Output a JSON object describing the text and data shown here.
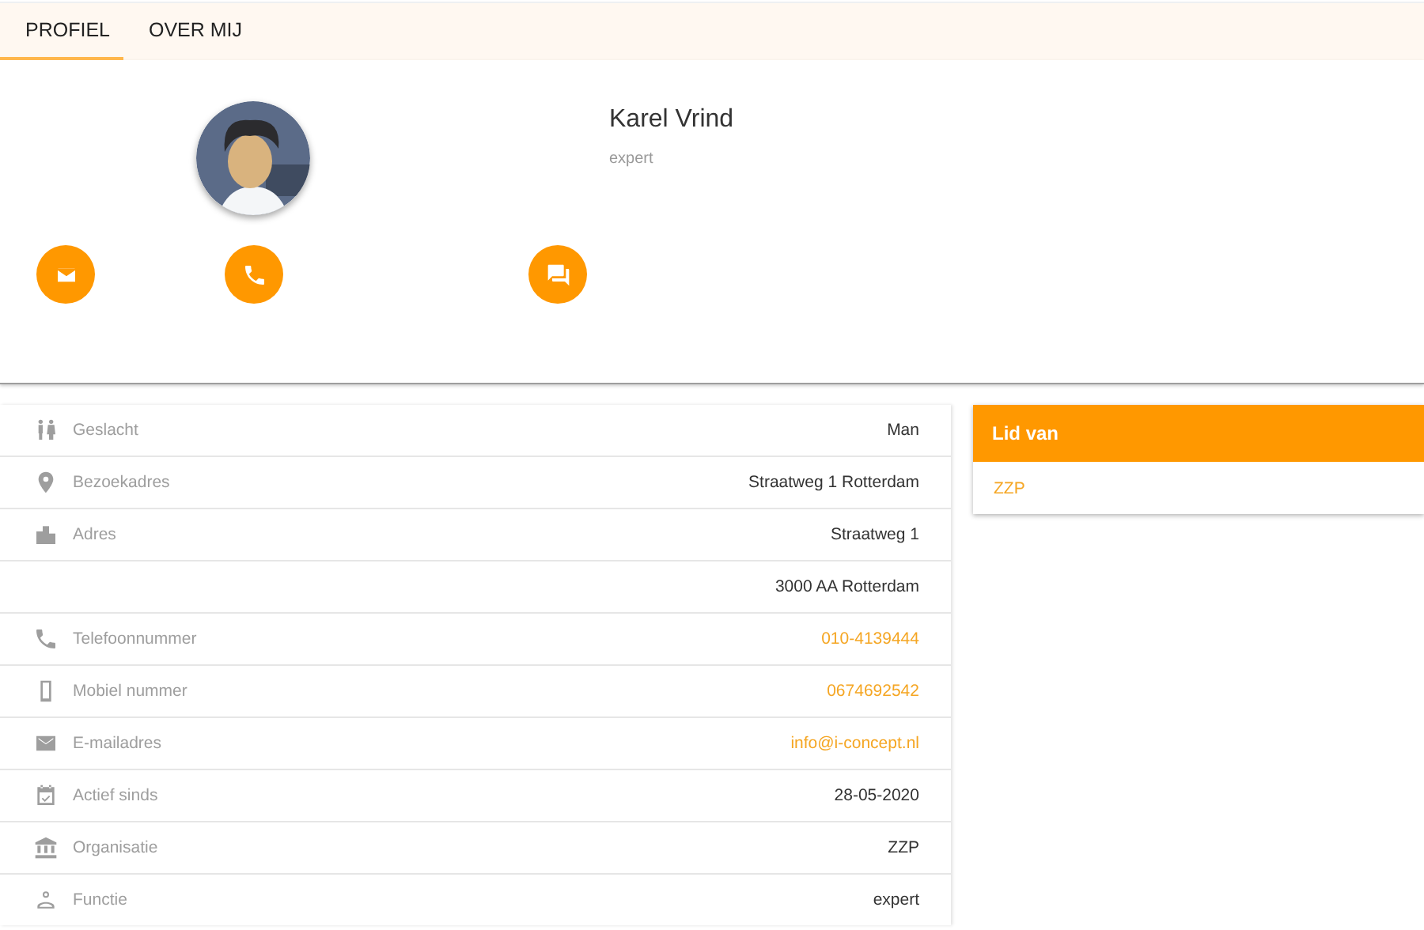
{
  "tabs": [
    {
      "label": "PROFIEL",
      "selected": true
    },
    {
      "label": "OVER MIJ",
      "selected": false
    }
  ],
  "profile": {
    "name": "Karel Vrind",
    "role": "expert",
    "actions": [
      {
        "kind": "mail"
      },
      {
        "kind": "phone"
      },
      {
        "kind": "chat"
      }
    ]
  },
  "details": [
    {
      "kind": "gender",
      "label": "Geslacht",
      "value": "Man",
      "link": false
    },
    {
      "kind": "pin",
      "label": "Bezoekadres",
      "value": "Straatweg 1 Rotterdam",
      "link": false
    },
    {
      "kind": "city",
      "label": "Adres",
      "value": "Straatweg 1",
      "link": false
    },
    {
      "kind": "blank",
      "value": "3000 AA Rotterdam",
      "link": false
    },
    {
      "kind": "phone",
      "label": "Telefoonnummer",
      "value": "010-4139444",
      "link": true
    },
    {
      "kind": "mobile",
      "label": "Mobiel nummer",
      "value": "0674692542",
      "link": true
    },
    {
      "kind": "mail",
      "label": "E-mailadres",
      "value": "info@i-concept.nl",
      "link": true
    },
    {
      "kind": "calendar",
      "label": "Actief sinds",
      "value": "28-05-2020",
      "link": false
    },
    {
      "kind": "bank",
      "label": "Organisatie",
      "value": "ZZP",
      "link": false
    },
    {
      "kind": "person",
      "label": "Functie",
      "value": "expert",
      "link": false
    }
  ],
  "member_of": {
    "title": "Lid van",
    "items": [
      "ZZP"
    ]
  }
}
